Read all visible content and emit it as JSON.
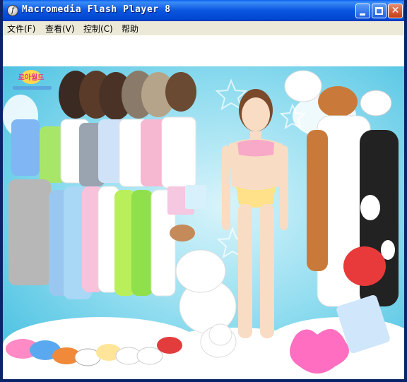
{
  "window": {
    "title": "Macromedia Flash Player 8",
    "icon": "flash-player-icon",
    "controls": {
      "minimize": "minimize-icon",
      "maximize": "maximize-icon",
      "close": "close-icon"
    }
  },
  "menu": {
    "items": [
      {
        "label": "文件(F)"
      },
      {
        "label": "查看(V)"
      },
      {
        "label": "控制(C)"
      },
      {
        "label": "帮助"
      }
    ]
  },
  "game": {
    "logo": "site-logo",
    "colors": {
      "background": "#7fd3ea",
      "cloud": "#ffffff",
      "skin": "#f8dcc4",
      "bikini": "#f7a9c7"
    },
    "items": [
      "hair-styles",
      "pajama-tops",
      "pajama-bottoms",
      "slippers",
      "doll-model",
      "animal-hoods",
      "animal-onesies",
      "teddy-bear",
      "pillows",
      "hairbrush",
      "gift-bags"
    ]
  }
}
